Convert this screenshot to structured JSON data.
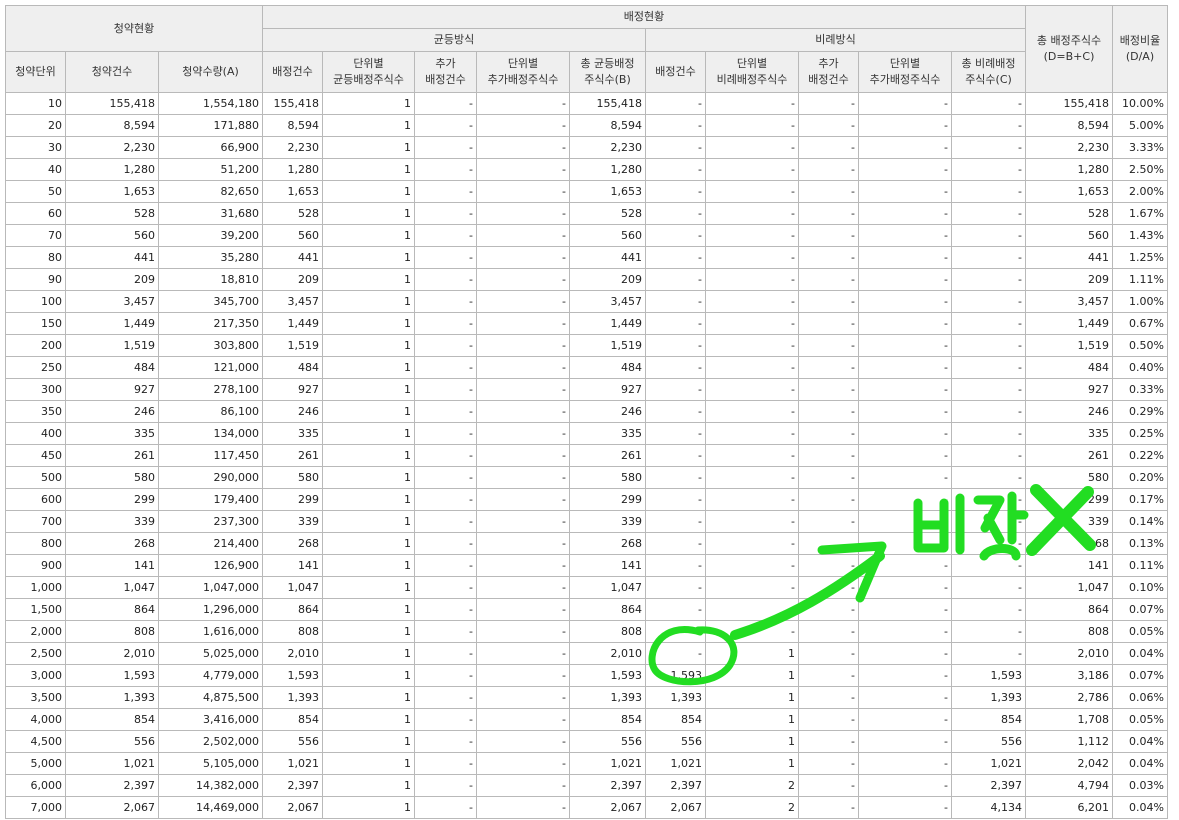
{
  "headers": {
    "group_subscription": "청약현황",
    "group_allocation": "배정현황",
    "equal_method": "균등방식",
    "proportional_method": "비례방식",
    "total_alloc": "총 배정주식수\n(D=B+C)",
    "alloc_ratio": "배정비율\n(D/A)",
    "cols": [
      "청약단위",
      "청약건수",
      "청약수량(A)",
      "배정건수",
      "단위별\n균등배정주식수",
      "추가\n배정건수",
      "단위별\n추가배정주식수",
      "총 균등배정\n주식수(B)",
      "배정건수",
      "단위별\n비례배정주식수",
      "추가\n배정건수",
      "단위별\n추가배정주식수",
      "총 비례배정\n주식수(C)"
    ]
  },
  "rows": [
    [
      "10",
      "155,418",
      "1,554,180",
      "155,418",
      "1",
      "-",
      "-",
      "155,418",
      "-",
      "-",
      "-",
      "-",
      "-",
      "155,418",
      "10.00%"
    ],
    [
      "20",
      "8,594",
      "171,880",
      "8,594",
      "1",
      "-",
      "-",
      "8,594",
      "-",
      "-",
      "-",
      "-",
      "-",
      "8,594",
      "5.00%"
    ],
    [
      "30",
      "2,230",
      "66,900",
      "2,230",
      "1",
      "-",
      "-",
      "2,230",
      "-",
      "-",
      "-",
      "-",
      "-",
      "2,230",
      "3.33%"
    ],
    [
      "40",
      "1,280",
      "51,200",
      "1,280",
      "1",
      "-",
      "-",
      "1,280",
      "-",
      "-",
      "-",
      "-",
      "-",
      "1,280",
      "2.50%"
    ],
    [
      "50",
      "1,653",
      "82,650",
      "1,653",
      "1",
      "-",
      "-",
      "1,653",
      "-",
      "-",
      "-",
      "-",
      "-",
      "1,653",
      "2.00%"
    ],
    [
      "60",
      "528",
      "31,680",
      "528",
      "1",
      "-",
      "-",
      "528",
      "-",
      "-",
      "-",
      "-",
      "-",
      "528",
      "1.67%"
    ],
    [
      "70",
      "560",
      "39,200",
      "560",
      "1",
      "-",
      "-",
      "560",
      "-",
      "-",
      "-",
      "-",
      "-",
      "560",
      "1.43%"
    ],
    [
      "80",
      "441",
      "35,280",
      "441",
      "1",
      "-",
      "-",
      "441",
      "-",
      "-",
      "-",
      "-",
      "-",
      "441",
      "1.25%"
    ],
    [
      "90",
      "209",
      "18,810",
      "209",
      "1",
      "-",
      "-",
      "209",
      "-",
      "-",
      "-",
      "-",
      "-",
      "209",
      "1.11%"
    ],
    [
      "100",
      "3,457",
      "345,700",
      "3,457",
      "1",
      "-",
      "-",
      "3,457",
      "-",
      "-",
      "-",
      "-",
      "-",
      "3,457",
      "1.00%"
    ],
    [
      "150",
      "1,449",
      "217,350",
      "1,449",
      "1",
      "-",
      "-",
      "1,449",
      "-",
      "-",
      "-",
      "-",
      "-",
      "1,449",
      "0.67%"
    ],
    [
      "200",
      "1,519",
      "303,800",
      "1,519",
      "1",
      "-",
      "-",
      "1,519",
      "-",
      "-",
      "-",
      "-",
      "-",
      "1,519",
      "0.50%"
    ],
    [
      "250",
      "484",
      "121,000",
      "484",
      "1",
      "-",
      "-",
      "484",
      "-",
      "-",
      "-",
      "-",
      "-",
      "484",
      "0.40%"
    ],
    [
      "300",
      "927",
      "278,100",
      "927",
      "1",
      "-",
      "-",
      "927",
      "-",
      "-",
      "-",
      "-",
      "-",
      "927",
      "0.33%"
    ],
    [
      "350",
      "246",
      "86,100",
      "246",
      "1",
      "-",
      "-",
      "246",
      "-",
      "-",
      "-",
      "-",
      "-",
      "246",
      "0.29%"
    ],
    [
      "400",
      "335",
      "134,000",
      "335",
      "1",
      "-",
      "-",
      "335",
      "-",
      "-",
      "-",
      "-",
      "-",
      "335",
      "0.25%"
    ],
    [
      "450",
      "261",
      "117,450",
      "261",
      "1",
      "-",
      "-",
      "261",
      "-",
      "-",
      "-",
      "-",
      "-",
      "261",
      "0.22%"
    ],
    [
      "500",
      "580",
      "290,000",
      "580",
      "1",
      "-",
      "-",
      "580",
      "-",
      "-",
      "-",
      "-",
      "-",
      "580",
      "0.20%"
    ],
    [
      "600",
      "299",
      "179,400",
      "299",
      "1",
      "-",
      "-",
      "299",
      "-",
      "-",
      "-",
      "-",
      "-",
      "299",
      "0.17%"
    ],
    [
      "700",
      "339",
      "237,300",
      "339",
      "1",
      "-",
      "-",
      "339",
      "-",
      "-",
      "-",
      "-",
      "-",
      "339",
      "0.14%"
    ],
    [
      "800",
      "268",
      "214,400",
      "268",
      "1",
      "-",
      "-",
      "268",
      "-",
      "-",
      "-",
      "-",
      "-",
      "268",
      "0.13%"
    ],
    [
      "900",
      "141",
      "126,900",
      "141",
      "1",
      "-",
      "-",
      "141",
      "-",
      "-",
      "-",
      "-",
      "-",
      "141",
      "0.11%"
    ],
    [
      "1,000",
      "1,047",
      "1,047,000",
      "1,047",
      "1",
      "-",
      "-",
      "1,047",
      "-",
      "-",
      "-",
      "-",
      "-",
      "1,047",
      "0.10%"
    ],
    [
      "1,500",
      "864",
      "1,296,000",
      "864",
      "1",
      "-",
      "-",
      "864",
      "-",
      "-",
      "-",
      "-",
      "-",
      "864",
      "0.07%"
    ],
    [
      "2,000",
      "808",
      "1,616,000",
      "808",
      "1",
      "-",
      "-",
      "808",
      "-",
      "-",
      "-",
      "-",
      "-",
      "808",
      "0.05%"
    ],
    [
      "2,500",
      "2,010",
      "5,025,000",
      "2,010",
      "1",
      "-",
      "-",
      "2,010",
      "-",
      "1",
      "-",
      "-",
      "-",
      "2,010",
      "0.04%"
    ],
    [
      "3,000",
      "1,593",
      "4,779,000",
      "1,593",
      "1",
      "-",
      "-",
      "1,593",
      "1,593",
      "1",
      "-",
      "-",
      "1,593",
      "3,186",
      "0.07%"
    ],
    [
      "3,500",
      "1,393",
      "4,875,500",
      "1,393",
      "1",
      "-",
      "-",
      "1,393",
      "1,393",
      "1",
      "-",
      "-",
      "1,393",
      "2,786",
      "0.06%"
    ],
    [
      "4,000",
      "854",
      "3,416,000",
      "854",
      "1",
      "-",
      "-",
      "854",
      "854",
      "1",
      "-",
      "-",
      "854",
      "1,708",
      "0.05%"
    ],
    [
      "4,500",
      "556",
      "2,502,000",
      "556",
      "1",
      "-",
      "-",
      "556",
      "556",
      "1",
      "-",
      "-",
      "556",
      "1,112",
      "0.04%"
    ],
    [
      "5,000",
      "1,021",
      "5,105,000",
      "1,021",
      "1",
      "-",
      "-",
      "1,021",
      "1,021",
      "1",
      "-",
      "-",
      "1,021",
      "2,042",
      "0.04%"
    ],
    [
      "6,000",
      "2,397",
      "14,382,000",
      "2,397",
      "1",
      "-",
      "-",
      "2,397",
      "2,397",
      "2",
      "-",
      "-",
      "2,397",
      "4,794",
      "0.03%"
    ],
    [
      "7,000",
      "2,067",
      "14,469,000",
      "2,067",
      "1",
      "-",
      "-",
      "2,067",
      "2,067",
      "2",
      "-",
      "-",
      "4,134",
      "6,201",
      "0.04%"
    ]
  ],
  "annotation": {
    "text": "배정X",
    "color": "#22dd22"
  }
}
